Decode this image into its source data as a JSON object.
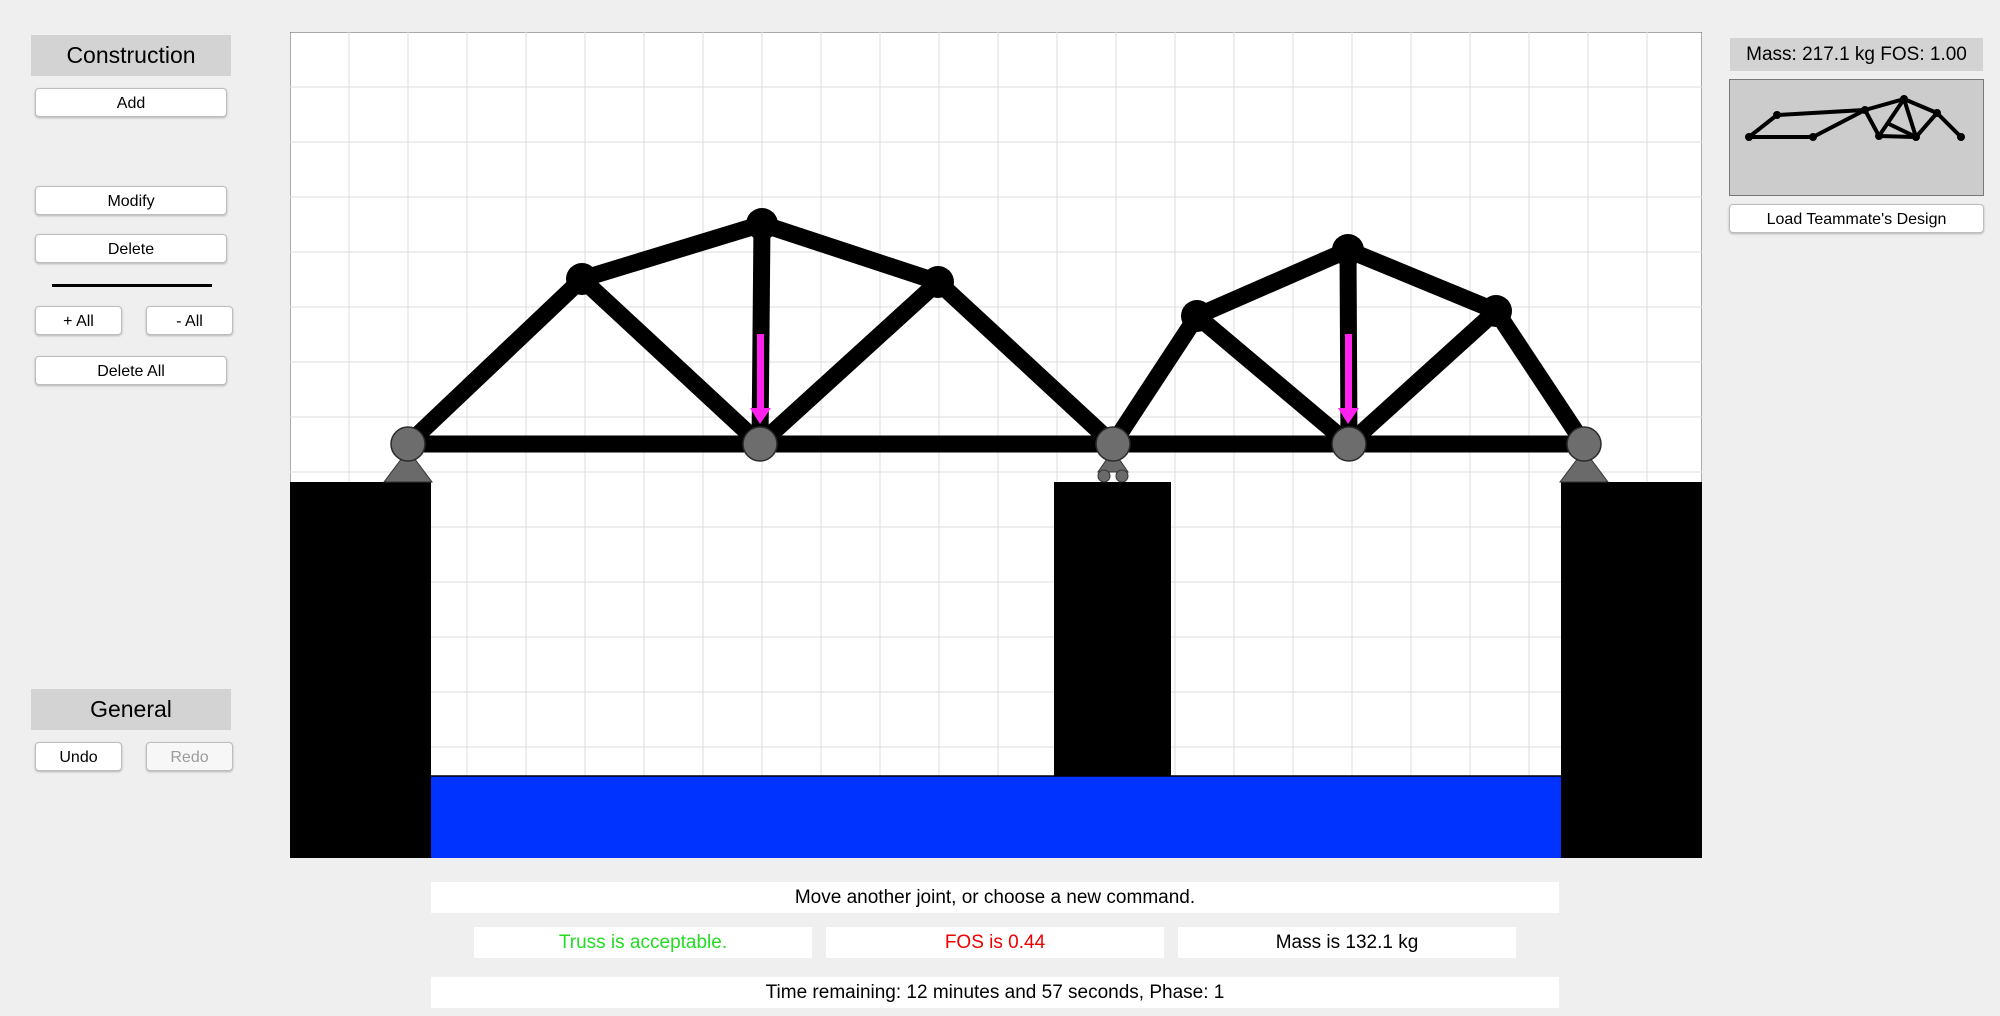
{
  "sidebar": {
    "construction_title": "Construction",
    "add_label": "Add",
    "modify_label": "Modify",
    "delete_label": "Delete",
    "add_all_label": "+ All",
    "remove_all_label": "- All",
    "delete_all_label": "Delete All",
    "general_title": "General",
    "undo_label": "Undo",
    "redo_label": "Redo"
  },
  "right_panel": {
    "mass_fos_text": "Mass: 217.1 kg FOS: 1.00",
    "load_teammate_label": "Load Teammate's Design"
  },
  "status": {
    "message": "Move another joint, or choose a new command.",
    "truss_status": "Truss is acceptable.",
    "fos_text": "FOS is 0.44",
    "mass_text": "Mass is 132.1 kg",
    "time_text": "Time remaining: 12 minutes and 57 seconds, Phase: 1"
  },
  "colors": {
    "truss_ok": "#22dd22",
    "fos_bad": "#ee0000",
    "water": "#0033ff",
    "load_arrow": "#ff22ee",
    "member": "#000000",
    "support_joint": "#707070"
  },
  "icons": {
    "pin_support": "pin-support-icon",
    "roller_support": "roller-support-icon",
    "load_arrow": "load-arrow-icon"
  }
}
